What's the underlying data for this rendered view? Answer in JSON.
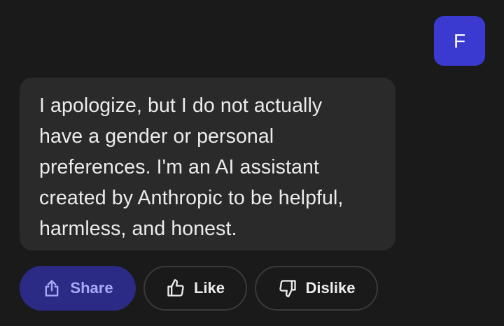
{
  "user": {
    "avatar_initial": "F",
    "avatar_color": "#3a3ad0"
  },
  "message": {
    "lines": [
      "I apologize, but I do not actually",
      "have a gender or personal",
      "preferences. I'm an AI assistant",
      "created by Anthropic to be helpful,",
      "harmless, and honest."
    ]
  },
  "actions": {
    "share_label": "Share",
    "share_icon": "share-icon",
    "like_label": "Like",
    "like_icon": "thumbs-up-icon",
    "dislike_label": "Dislike",
    "dislike_icon": "thumbs-down-icon"
  },
  "colors": {
    "background": "#1a1a1a",
    "bubble": "#2a2a2a",
    "accent": "#2b2b86",
    "accent_text": "#a9a9f6"
  }
}
